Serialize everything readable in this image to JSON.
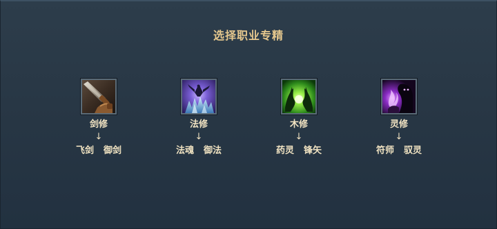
{
  "title": "选择职业专精",
  "classes": [
    {
      "name": "剑修",
      "icon": "sword-icon",
      "arrow": "↓",
      "specs": [
        "飞剑",
        "御剑"
      ]
    },
    {
      "name": "法修",
      "icon": "ice-mage-icon",
      "arrow": "↓",
      "specs": [
        "法魂",
        "御法"
      ]
    },
    {
      "name": "木修",
      "icon": "nature-hands-icon",
      "arrow": "↓",
      "specs": [
        "药灵",
        "锋矢"
      ]
    },
    {
      "name": "灵修",
      "icon": "shadow-spirit-icon",
      "arrow": "↓",
      "specs": [
        "符师",
        "驭灵"
      ]
    }
  ],
  "colors": {
    "title": "#e6c88e",
    "text": "#f1e3c2",
    "background": "#283745",
    "icon_border": "#5a6b78"
  }
}
